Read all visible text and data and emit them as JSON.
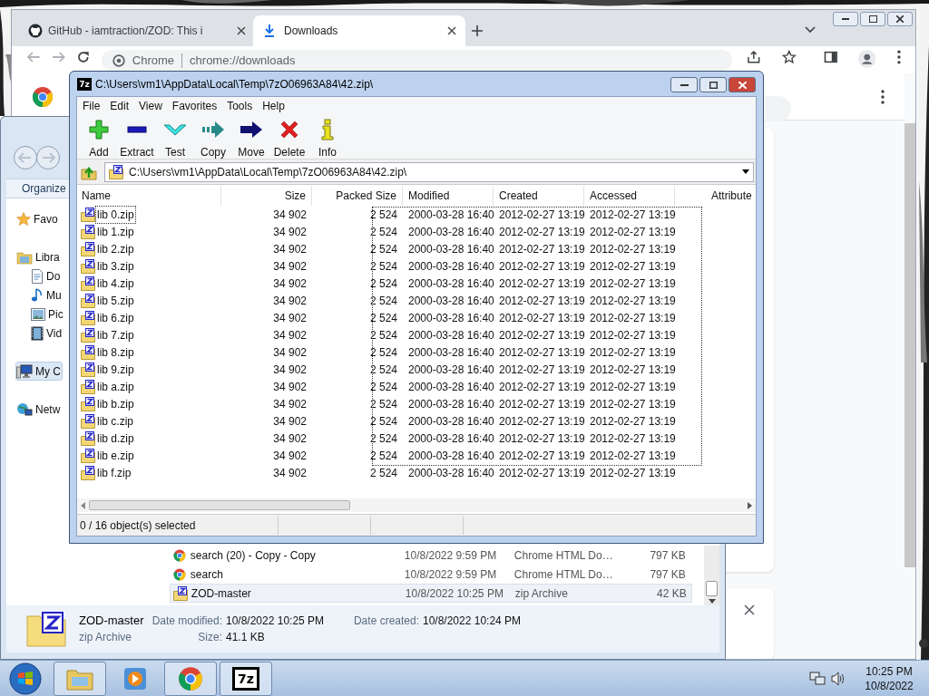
{
  "chrome": {
    "tabs": [
      {
        "label": "GitHub - iamtraction/ZOD: This i",
        "kind": "github",
        "selected": false
      },
      {
        "label": "Downloads",
        "kind": "download",
        "selected": true
      }
    ],
    "omnibox": {
      "origin": "Chrome",
      "url": "chrome://downloads"
    }
  },
  "explorer": {
    "toolbar": [
      "Organize"
    ],
    "nav": [
      {
        "label": "Favo",
        "kind": "star",
        "selected": false
      },
      {
        "label": "Libra",
        "kind": "library",
        "selected": false,
        "children": [
          {
            "label": "Do",
            "kind": "document",
            "selected": false
          },
          {
            "label": "Mu",
            "kind": "music",
            "selected": false
          },
          {
            "label": "Pic",
            "kind": "picture",
            "selected": false
          },
          {
            "label": "Vid",
            "kind": "video",
            "selected": false
          }
        ]
      },
      {
        "label": "My C",
        "kind": "computer",
        "selected": true
      },
      {
        "label": "Netw",
        "kind": "network",
        "selected": false
      }
    ],
    "files": [
      {
        "name": "search (20) - Copy - Copy",
        "date": "10/8/2022 9:59 PM",
        "type": "Chrome HTML Do…",
        "size": "797 KB",
        "kind": "chrome",
        "selected": false
      },
      {
        "name": "search",
        "date": "10/8/2022 9:59 PM",
        "type": "Chrome HTML Do…",
        "size": "797 KB",
        "kind": "chrome",
        "selected": false
      },
      {
        "name": "ZOD-master",
        "date": "10/8/2022 10:25 PM",
        "type": "zip Archive",
        "size": "42 KB",
        "kind": "zip",
        "selected": true
      }
    ],
    "details": {
      "name": "ZOD-master",
      "type": "zip Archive",
      "modified_label": "Date modified:",
      "modified": "10/8/2022 10:25 PM",
      "created_label": "Date created:",
      "created": "10/8/2022 10:24 PM",
      "size_label": "Size:",
      "size": "41.1 KB"
    }
  },
  "sevenzip": {
    "title": "C:\\Users\\vm1\\AppData\\Local\\Temp\\7zO06963A84\\42.zip\\",
    "icon_text": "7z",
    "menu": [
      "File",
      "Edit",
      "View",
      "Favorites",
      "Tools",
      "Help"
    ],
    "toolbar": [
      {
        "kind": "add",
        "label": "Add"
      },
      {
        "kind": "extract",
        "label": "Extract"
      },
      {
        "kind": "test",
        "label": "Test"
      },
      {
        "kind": "copy",
        "label": "Copy"
      },
      {
        "kind": "move",
        "label": "Move"
      },
      {
        "kind": "delete",
        "label": "Delete"
      },
      {
        "kind": "info",
        "label": "Info"
      }
    ],
    "address": "C:\\Users\\vm1\\AppData\\Local\\Temp\\7zO06963A84\\42.zip\\",
    "columns": [
      "Name",
      "Size",
      "Packed Size",
      "Modified",
      "Created",
      "Accessed",
      "Attribute"
    ],
    "rows": [
      {
        "name": "lib 0.zip",
        "size": "34 902",
        "packed": "2 524",
        "modified": "2000-03-28 16:40",
        "created": "2012-02-27 13:19",
        "accessed": "2012-02-27 13:19",
        "focused": true
      },
      {
        "name": "lib 1.zip",
        "size": "34 902",
        "packed": "2 524",
        "modified": "2000-03-28 16:40",
        "created": "2012-02-27 13:19",
        "accessed": "2012-02-27 13:19",
        "focused": false
      },
      {
        "name": "lib 2.zip",
        "size": "34 902",
        "packed": "2 524",
        "modified": "2000-03-28 16:40",
        "created": "2012-02-27 13:19",
        "accessed": "2012-02-27 13:19",
        "focused": false
      },
      {
        "name": "lib 3.zip",
        "size": "34 902",
        "packed": "2 524",
        "modified": "2000-03-28 16:40",
        "created": "2012-02-27 13:19",
        "accessed": "2012-02-27 13:19",
        "focused": false
      },
      {
        "name": "lib 4.zip",
        "size": "34 902",
        "packed": "2 524",
        "modified": "2000-03-28 16:40",
        "created": "2012-02-27 13:19",
        "accessed": "2012-02-27 13:19",
        "focused": false
      },
      {
        "name": "lib 5.zip",
        "size": "34 902",
        "packed": "2 524",
        "modified": "2000-03-28 16:40",
        "created": "2012-02-27 13:19",
        "accessed": "2012-02-27 13:19",
        "focused": false
      },
      {
        "name": "lib 6.zip",
        "size": "34 902",
        "packed": "2 524",
        "modified": "2000-03-28 16:40",
        "created": "2012-02-27 13:19",
        "accessed": "2012-02-27 13:19",
        "focused": false
      },
      {
        "name": "lib 7.zip",
        "size": "34 902",
        "packed": "2 524",
        "modified": "2000-03-28 16:40",
        "created": "2012-02-27 13:19",
        "accessed": "2012-02-27 13:19",
        "focused": false
      },
      {
        "name": "lib 8.zip",
        "size": "34 902",
        "packed": "2 524",
        "modified": "2000-03-28 16:40",
        "created": "2012-02-27 13:19",
        "accessed": "2012-02-27 13:19",
        "focused": false
      },
      {
        "name": "lib 9.zip",
        "size": "34 902",
        "packed": "2 524",
        "modified": "2000-03-28 16:40",
        "created": "2012-02-27 13:19",
        "accessed": "2012-02-27 13:19",
        "focused": false
      },
      {
        "name": "lib a.zip",
        "size": "34 902",
        "packed": "2 524",
        "modified": "2000-03-28 16:40",
        "created": "2012-02-27 13:19",
        "accessed": "2012-02-27 13:19",
        "focused": false
      },
      {
        "name": "lib b.zip",
        "size": "34 902",
        "packed": "2 524",
        "modified": "2000-03-28 16:40",
        "created": "2012-02-27 13:19",
        "accessed": "2012-02-27 13:19",
        "focused": false
      },
      {
        "name": "lib c.zip",
        "size": "34 902",
        "packed": "2 524",
        "modified": "2000-03-28 16:40",
        "created": "2012-02-27 13:19",
        "accessed": "2012-02-27 13:19",
        "focused": false
      },
      {
        "name": "lib d.zip",
        "size": "34 902",
        "packed": "2 524",
        "modified": "2000-03-28 16:40",
        "created": "2012-02-27 13:19",
        "accessed": "2012-02-27 13:19",
        "focused": false
      },
      {
        "name": "lib e.zip",
        "size": "34 902",
        "packed": "2 524",
        "modified": "2000-03-28 16:40",
        "created": "2012-02-27 13:19",
        "accessed": "2012-02-27 13:19",
        "focused": false
      },
      {
        "name": "lib f.zip",
        "size": "34 902",
        "packed": "2 524",
        "modified": "2000-03-28 16:40",
        "created": "2012-02-27 13:19",
        "accessed": "2012-02-27 13:19",
        "focused": false
      }
    ],
    "status": "0 / 16 object(s) selected"
  },
  "taskbar": {
    "buttons": [
      {
        "kind": "explorer",
        "running": true
      },
      {
        "kind": "media",
        "running": false
      },
      {
        "kind": "chrome",
        "running": true
      },
      {
        "kind": "sevenzip",
        "running": true,
        "label": "7z"
      }
    ],
    "clock": {
      "time": "10:25 PM",
      "date": "10/8/2022"
    }
  }
}
